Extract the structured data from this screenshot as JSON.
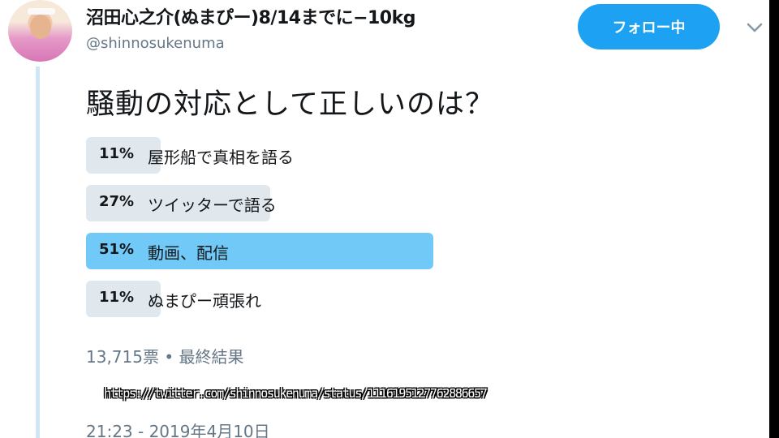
{
  "tweet": {
    "display_name": "沼田心之介(ぬまぴー)8/14までに−10kg",
    "handle": "@shinnosukenuma",
    "follow_label": "フォロー中",
    "question": "騒動の対応として正しいのは？",
    "poll": {
      "options": [
        {
          "percent": "11%",
          "label": "屋形船で真相を語る",
          "value": 11,
          "winner": false
        },
        {
          "percent": "27%",
          "label": "ツイッターで語る",
          "value": 27,
          "winner": false
        },
        {
          "percent": "51%",
          "label": "動画、配信",
          "value": 51,
          "winner": true
        },
        {
          "percent": "11%",
          "label": "ぬまぴー頑張れ",
          "value": 11,
          "winner": false
        }
      ],
      "summary": "13,715票 • 最終結果"
    },
    "url_overlay": "https://twitter.com/shinnosukenuma/status/1116195127762886657",
    "timestamp": "21:23 - 2019年4月10日"
  },
  "icons": {
    "avatar": "profile-photo",
    "menu": "chevron-down-icon"
  },
  "colors": {
    "accent": "#1da1f2",
    "winner_bar": "#71c9f8",
    "bar": "#e1e8ed",
    "muted_text": "#657786"
  }
}
